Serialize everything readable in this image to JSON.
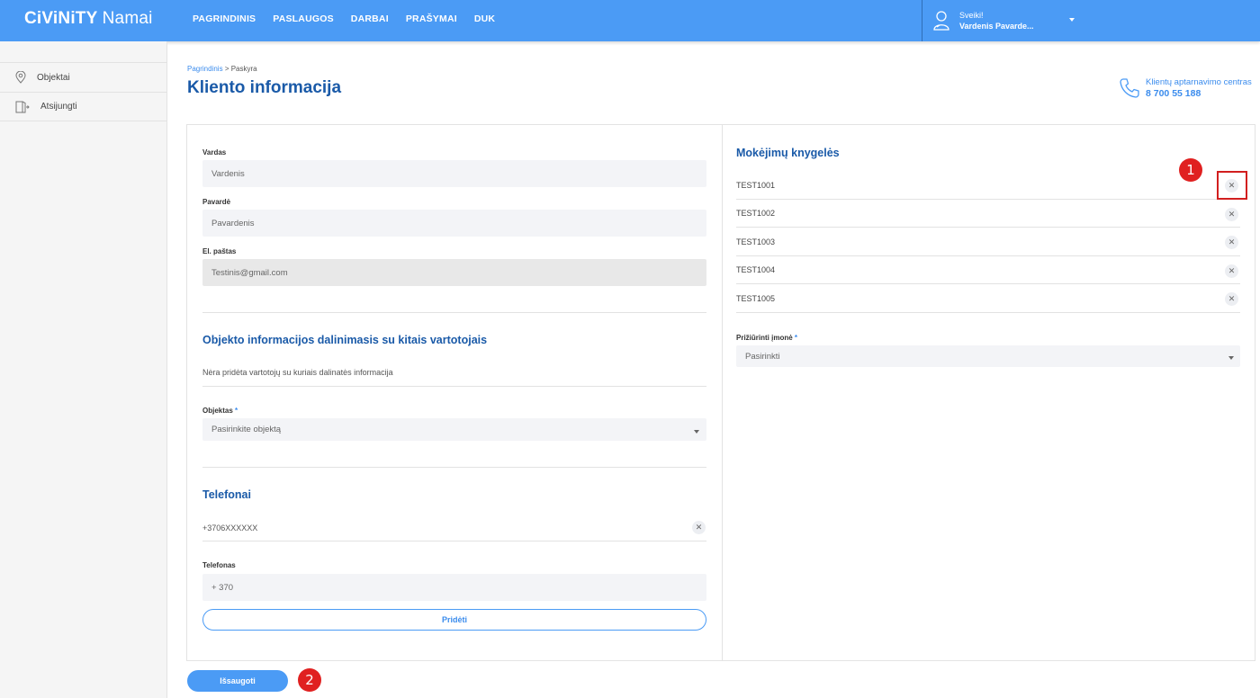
{
  "app": {
    "logo_bold": "CiViNiTY",
    "logo_light": "Namai"
  },
  "nav": [
    "PAGRINDINIS",
    "PASLAUGOS",
    "DARBAI",
    "PRAŠYMAI",
    "DUK"
  ],
  "user": {
    "greeting": "Sveiki!",
    "name": "Vardenis Pavarde..."
  },
  "sidebar": {
    "items": [
      {
        "label": "Objektai",
        "icon": "location-pin-icon"
      },
      {
        "label": "Atsijungti",
        "icon": "logout-door-icon"
      }
    ]
  },
  "breadcrumb": {
    "home": "Pagrindinis",
    "separator": ">",
    "current": "Paskyra"
  },
  "page": {
    "title": "Kliento informacija"
  },
  "contact": {
    "label": "Klientų aptarnavimo centras",
    "phone": "8 700 55 188"
  },
  "form": {
    "first_name": {
      "label": "Vardas",
      "value": "Vardenis"
    },
    "last_name": {
      "label": "Pavardė",
      "value": "Pavardenis"
    },
    "email": {
      "label": "El. paštas",
      "value": "Testinis@gmail.com"
    },
    "sharing": {
      "title": "Objekto informacijos dalinimasis su kitais vartotojais",
      "empty_text": "Nėra pridėta vartotojų su kuriais dalinatės informacija",
      "object_label": "Objektas",
      "required_mark": "*",
      "object_placeholder": "Pasirinkite objektą"
    },
    "phones": {
      "title": "Telefonai",
      "existing": "+3706XXXXXX",
      "input_label": "Telefonas",
      "input_placeholder": "+ 370",
      "add_label": "Pridėti"
    },
    "save_label": "Išsaugoti"
  },
  "payment_books": {
    "title": "Mokėjimų knygelės",
    "items": [
      "TEST1001",
      "TEST1002",
      "TEST1003",
      "TEST1004",
      "TEST1005"
    ],
    "company_label": "Prižiūrinti įmonė",
    "required_mark": "*",
    "company_placeholder": "Pasirinkti"
  },
  "annotations": {
    "marker_1": "1",
    "marker_2": "2",
    "color": "#e02020"
  },
  "colors": {
    "brand": "#4b9bf5",
    "title": "#1a5aa8",
    "link": "#3b8ced"
  }
}
